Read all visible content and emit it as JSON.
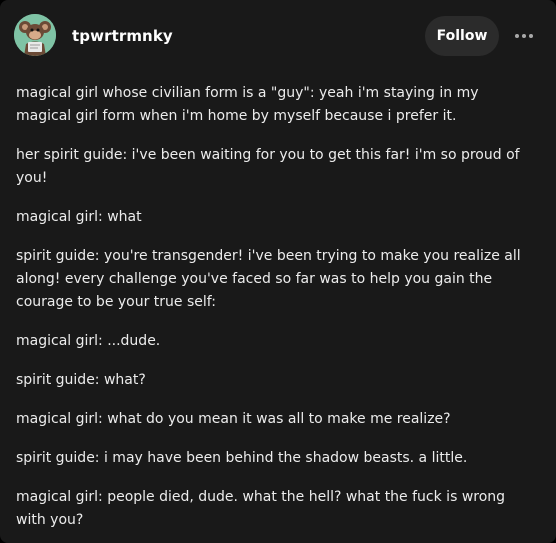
{
  "post": {
    "author": {
      "username": "tpwrtrmnky",
      "avatar_icon": "monkey-avatar-icon"
    },
    "follow_label": "Follow",
    "more_icon": "more-options-icon",
    "paragraphs": [
      "magical girl whose civilian form is a \"guy\": yeah i'm staying in my magical girl form when i'm home by myself because i prefer it.",
      "her spirit guide: i've been waiting for you to get this far! i'm so proud of you!",
      "magical girl: what",
      "spirit guide: you're transgender! i've been trying to make you realize all along! every challenge you've faced so far was to help you gain the courage to be your true self:",
      "magical girl: ...dude.",
      "spirit guide: what?",
      "magical girl: what do you mean it was all to make me realize?",
      "spirit guide: i may have been behind the shadow beasts. a little.",
      "magical girl: people died, dude. what the hell? what the fuck is wrong with you?"
    ]
  },
  "colors": {
    "card_background": "#191919",
    "text": "#ececec",
    "button_background": "#2b2b2b",
    "avatar_background": "#7fc3a5"
  }
}
